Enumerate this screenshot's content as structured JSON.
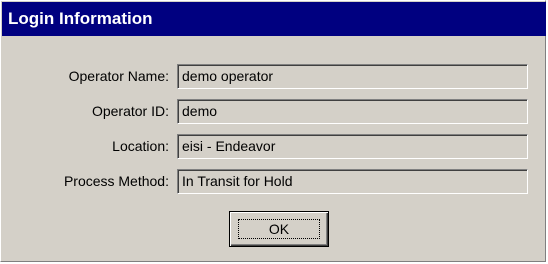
{
  "dialog": {
    "title": "Login Information"
  },
  "fields": [
    {
      "label": "Operator Name:",
      "value": "demo operator"
    },
    {
      "label": "Operator ID:",
      "value": "demo"
    },
    {
      "label": "Location:",
      "value": "eisi - Endeavor"
    },
    {
      "label": "Process Method:",
      "value": "In Transit for Hold"
    }
  ],
  "buttons": {
    "ok_label": "OK"
  },
  "colors": {
    "titlebar": "#000080",
    "dialog_bg": "#d4d0c8"
  }
}
